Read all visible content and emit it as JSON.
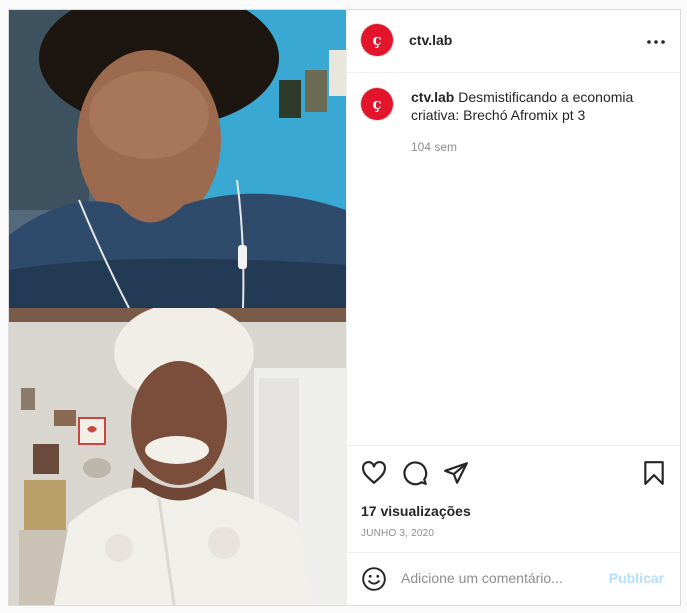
{
  "post": {
    "username": "ctv.lab",
    "avatar_letter": "ç",
    "caption_text": "Desmistificando a economia criativa: Brechó Afromix pt 3",
    "age": "104 sem",
    "views": "17 visualizações",
    "date": "JUNHO 3, 2020",
    "comment_placeholder": "Adicione um comentário...",
    "publish_label": "Publicar"
  },
  "colors": {
    "brand": "#e2152a",
    "publish": "#b2dffc"
  },
  "icons": [
    "more-options-icon",
    "heart-icon",
    "comment-icon",
    "share-icon",
    "bookmark-icon",
    "emoji-icon"
  ]
}
